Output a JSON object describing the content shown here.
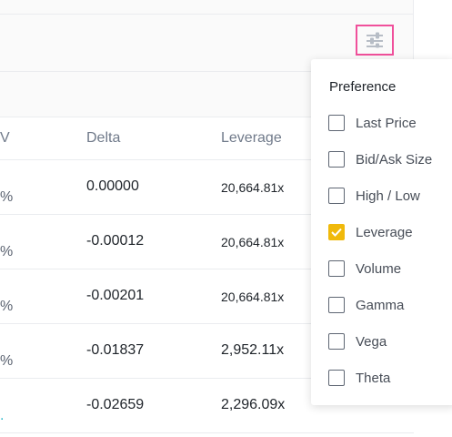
{
  "table": {
    "headers": {
      "partial_col": "V",
      "delta": "Delta",
      "leverage": "Leverage"
    },
    "rows": [
      {
        "pct": "%",
        "delta": "0.00000",
        "leverage": "20,664.81x"
      },
      {
        "pct": "%",
        "delta": "-0.00012",
        "leverage": "20,664.81x"
      },
      {
        "pct": "%",
        "delta": "-0.00201",
        "leverage": "20,664.81x"
      },
      {
        "pct": "%",
        "delta": "-0.01837",
        "leverage": "2,952.11x"
      },
      {
        "pct": ".",
        "delta": "-0.02659",
        "leverage": "2,296.09x"
      }
    ]
  },
  "settings": {
    "icon": "sliders-icon"
  },
  "preference": {
    "title": "Preference",
    "items": [
      {
        "label": "Last Price",
        "checked": false
      },
      {
        "label": "Bid/Ask Size",
        "checked": false
      },
      {
        "label": "High / Low",
        "checked": false
      },
      {
        "label": "Leverage",
        "checked": true
      },
      {
        "label": "Volume",
        "checked": false
      },
      {
        "label": "Gamma",
        "checked": false
      },
      {
        "label": "Vega",
        "checked": false
      },
      {
        "label": "Theta",
        "checked": false
      }
    ]
  },
  "colors": {
    "accent": "#f0b90b",
    "highlight_border": "#f0509b"
  }
}
